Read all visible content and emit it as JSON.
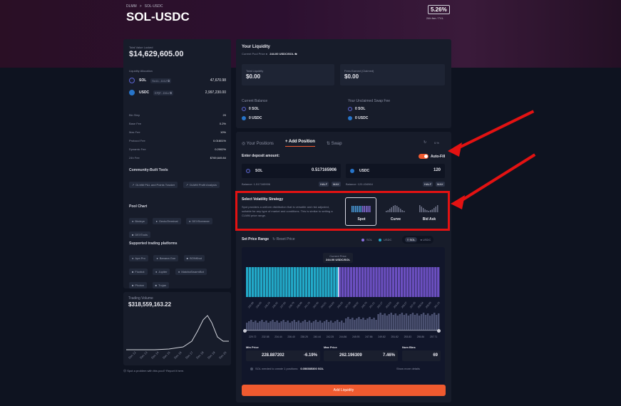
{
  "header": {
    "breadcrumb": [
      "DLMM",
      ">",
      "SOL-USDC"
    ],
    "title": "SOL-USDC",
    "fee_ratio": "5.26%",
    "fee_ratio_label": "24h fee / TVL"
  },
  "left": {
    "tvl_label": "Total Value Locked",
    "tvl": "$14,629,605.00",
    "alloc_label": "Liquidity Allocation",
    "alloc": [
      {
        "token": "SOL",
        "addr": "So11...1112 ⧉",
        "amount": "47,670.98"
      },
      {
        "token": "USDC",
        "addr": "EPjF...Dt1v ⧉",
        "amount": "2,997,230.00"
      }
    ],
    "stats": [
      {
        "k": "Bin Step",
        "v": "20"
      },
      {
        "k": "Base Fee",
        "v": "0.2%"
      },
      {
        "k": "Max Fee",
        "v": "10%"
      },
      {
        "k": "Protocol Fee",
        "v": "0.01601%"
      },
      {
        "k": "Dynamic Fee",
        "v": "0.2002%"
      },
      {
        "k": "24h Fee",
        "v": "$769,649.84"
      }
    ],
    "community_title": "Community-Built Tools",
    "community": [
      "DLMM P&L and Points Tracker",
      "DLMM Profit Analysis"
    ],
    "poolchart_title": "Pool Chart",
    "poolchart": [
      "Birdeye",
      "GeckoTerminal",
      "DEXScreener",
      "DEXTools"
    ],
    "platforms_title": "Supported trading platforms",
    "platforms": [
      "Ape.Pro",
      "Banana Gun",
      "BONKbot",
      "Fluxbot",
      "Jupiter",
      "MatchaSwarmBot",
      "Photon",
      "Trojan"
    ]
  },
  "volume": {
    "label": "Trading Volume",
    "value": "$318,559,163.22",
    "dates": [
      "Dec 12",
      "Dec 13",
      "Dec 14",
      "Dec 15",
      "Dec 16",
      "Dec 17",
      "Dec 18",
      "Dec 19",
      "Dec 20"
    ]
  },
  "report": "☹ Spot a problem with this pool? Report it here.",
  "liquidity": {
    "title": "Your Liquidity",
    "pool_price_label": "Current Pool Price ●",
    "pool_price": "244.00 USDC/SOL ⇆",
    "total_label": "Total Liquidity",
    "total": "$0.00",
    "fees_label": "Fees Earned (Claimed)",
    "fees": "$0.00",
    "balance_label": "Current Balance",
    "unclaimed_label": "Your Unclaimed Swap Fee",
    "bal_sol": "0 SOL",
    "bal_usdc": "0 USDC",
    "unc_sol": "0 SOL",
    "unc_usdc": "0 USDC"
  },
  "tabs": {
    "positions": "Your Positions",
    "add": "Add Position",
    "swap": "Swap",
    "slippage": "0.%"
  },
  "deposit": {
    "label": "Enter deposit amount:",
    "autofill": "Auto-Fill",
    "sol_token": "SOL",
    "sol_amount": "0.517165906",
    "sol_balance": "Balance: 1.517165906",
    "usdc_token": "USDC",
    "usdc_amount": "120",
    "usdc_balance": "Balance: 120.434964",
    "half": "HALF",
    "max": "MAX"
  },
  "strategy": {
    "title": "Select Volatility Strategy",
    "desc": "Spot provides a uniform distribution that is versatile and risk adjusted, suitable for any type of market and conditions. This is similar to setting a CLMM price range.",
    "options": [
      "Spot",
      "Curve",
      "Bid Ask"
    ]
  },
  "range": {
    "title": "Set Price Range",
    "reset": "↻ Reset Price",
    "legend_sol": "SOL",
    "legend_usdc": "USDC",
    "toggle_sol": "SOL",
    "toggle_usdc": "USDC",
    "current_label": "Current Price",
    "current_value": "244.00 USDC/SOL",
    "ticks": [
      "232.89",
      "234.06",
      "235.24",
      "236.42",
      "237.60",
      "238.79",
      "239.99",
      "241.19",
      "242.40",
      "243.61",
      "244.83",
      "246.05",
      "247.28",
      "248.52",
      "249.76",
      "251.01",
      "252.27",
      "253.53",
      "254.80",
      "256.07",
      "257.35",
      "258.64",
      "259.93",
      "261.23"
    ],
    "ticks2": [
      "229.72",
      "232.58",
      "234.44",
      "236.40",
      "238.25",
      "240.44",
      "242.25",
      "244.86",
      "245.93",
      "247.86",
      "249.82",
      "251.82",
      "253.83",
      "255.86",
      "257.71"
    ],
    "min_label": "Min Price",
    "min_value": "228.887202",
    "min_pct": "-6.19%",
    "max_label": "Max Price",
    "max_value": "262.196309",
    "max_pct": "7.46%",
    "bins_label": "Num Bins",
    "bins_value": "69",
    "rent_text": "SOL needed to create 1 positions:",
    "rent_value": "0.056585300 SOL",
    "more": "Show more details",
    "add_button": "Add Liquidity"
  },
  "colors": {
    "sol_bar": "#22a9c8",
    "usdc_bar": "#6b4fc0",
    "accent": "#ef5a2f",
    "annotation": "#e31212"
  }
}
